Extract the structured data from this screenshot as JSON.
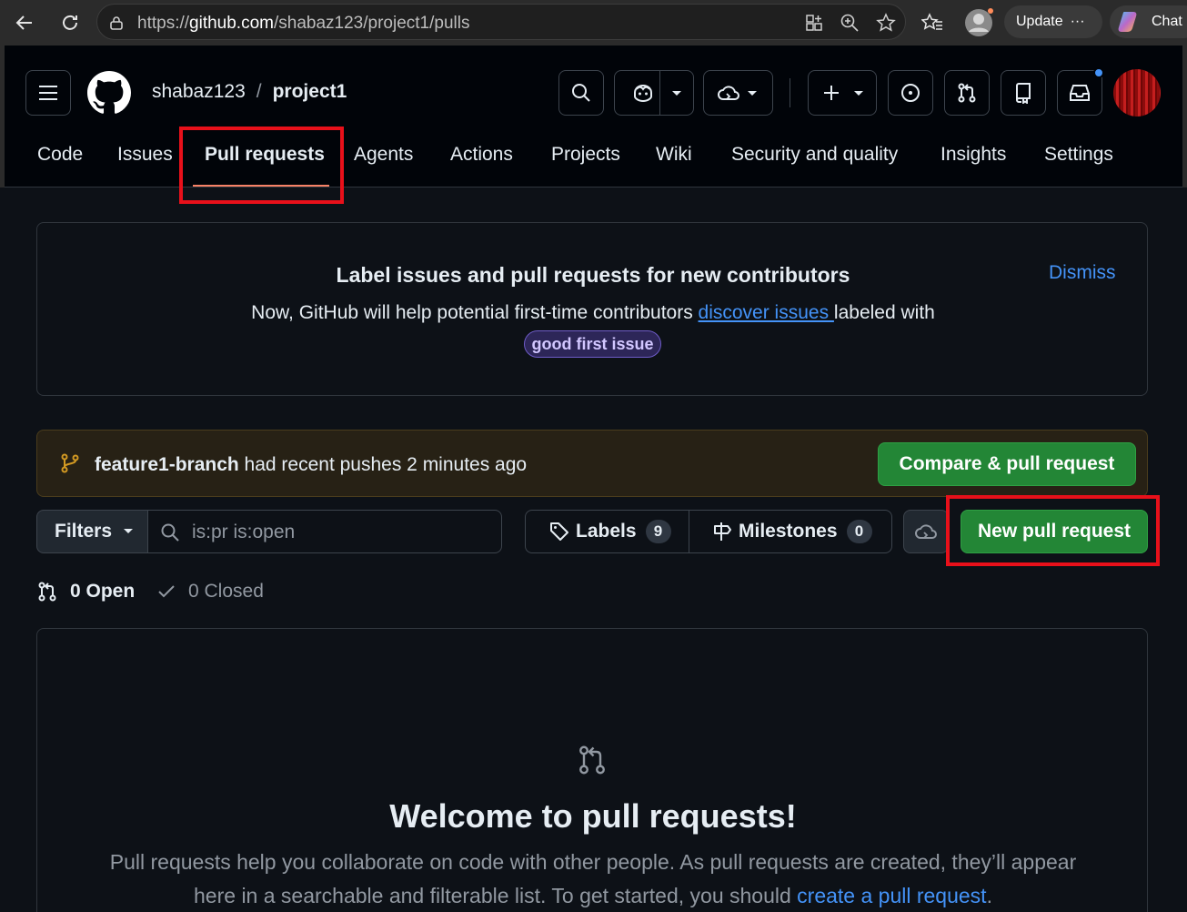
{
  "browser": {
    "url_prefix": "https://",
    "url_host": "github.com",
    "url_path": "/shabaz123/project1/pulls",
    "update_label": "Update",
    "more_label": "···",
    "chat_label": "Chat"
  },
  "repo": {
    "owner": "shabaz123",
    "separator": "/",
    "name": "project1"
  },
  "tabs": [
    {
      "label": "Code"
    },
    {
      "label": "Issues"
    },
    {
      "label": "Pull requests"
    },
    {
      "label": "Agents"
    },
    {
      "label": "Actions"
    },
    {
      "label": "Projects"
    },
    {
      "label": "Wiki"
    },
    {
      "label": "Security and quality"
    },
    {
      "label": "Insights"
    },
    {
      "label": "Settings"
    }
  ],
  "banner": {
    "title": "Label issues and pull requests for new contributors",
    "text_before": "Now, GitHub will help potential first-time contributors ",
    "link": "discover issues ",
    "text_after": "labeled with",
    "label": "good first issue",
    "dismiss": "Dismiss"
  },
  "push": {
    "branch": "feature1-branch",
    "message": " had recent pushes 2 minutes ago",
    "compare_label": "Compare & pull request"
  },
  "toolbar": {
    "filters_label": "Filters",
    "search_value": "is:pr is:open",
    "labels_label": "Labels",
    "labels_count": "9",
    "milestones_label": "Milestones",
    "milestones_count": "0",
    "new_pr_label": "New pull request"
  },
  "states": {
    "open_label": "0 Open",
    "closed_label": "0 Closed"
  },
  "blankslate": {
    "title": "Welcome to pull requests!",
    "desc_before": "Pull requests help you collaborate on code with other people. As pull requests are created, they’ll appear here in a searchable and filterable list. To get started, you should ",
    "desc_link": "create a pull request",
    "desc_after": "."
  },
  "colors": {
    "accent_red_box": "#e8101a",
    "primary_green": "#238636",
    "link_blue": "#4493f8",
    "underline_orange": "#f78166"
  }
}
